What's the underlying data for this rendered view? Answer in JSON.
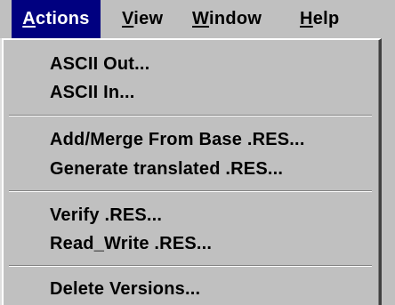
{
  "menubar": {
    "items": [
      {
        "label_key": "A",
        "label_rest": "ctions",
        "active": true
      },
      {
        "label_key": "V",
        "label_rest": "iew"
      },
      {
        "label_key": "W",
        "label_rest": "indow"
      },
      {
        "label_key": "H",
        "label_rest": "elp"
      }
    ]
  },
  "actions_menu": {
    "groups": [
      {
        "items": [
          "ASCII Out...",
          "ASCII In..."
        ]
      },
      {
        "items": [
          "Add/Merge From Base .RES...",
          "Generate translated .RES..."
        ]
      },
      {
        "items": [
          "Verify .RES...",
          "Read_Write .RES..."
        ]
      },
      {
        "items": [
          "Delete Versions..."
        ]
      }
    ]
  },
  "colors": {
    "menu_bg": "#c0c0c0",
    "highlight_bg": "#000080",
    "highlight_text": "#ffffff"
  }
}
